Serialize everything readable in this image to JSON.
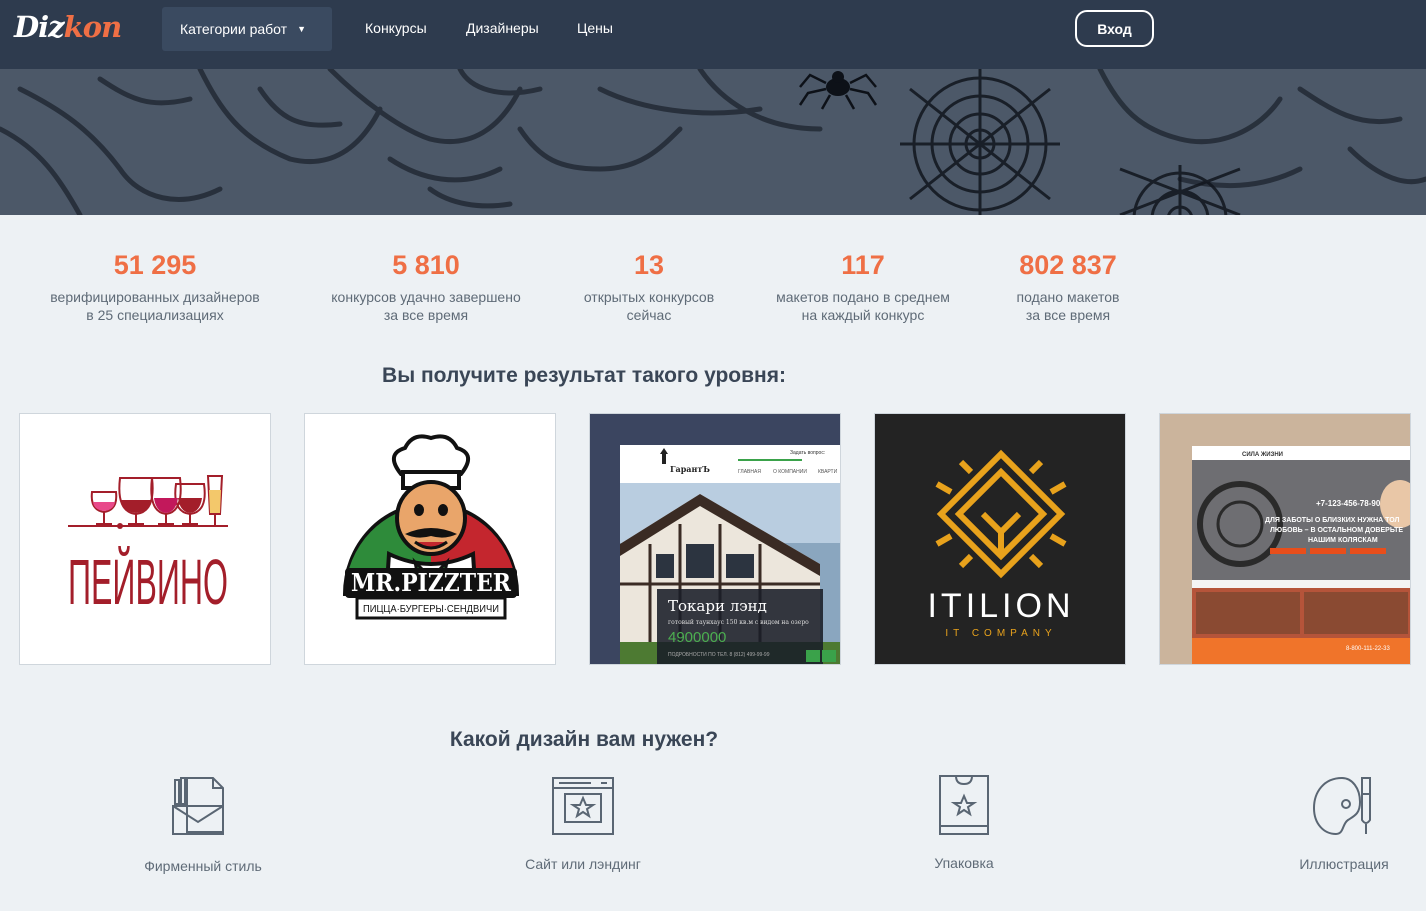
{
  "logo": {
    "part1": "Diz",
    "part2": "kon"
  },
  "nav": {
    "categories_label": "Категории работ",
    "links": [
      "Конкурсы",
      "Дизайнеры",
      "Цены"
    ],
    "login_label": "Вход"
  },
  "stats": [
    {
      "value": "51 295",
      "line1": "верифицированных дизайнеров",
      "line2": "в 25 специализациях"
    },
    {
      "value": "5 810",
      "line1": "конкурсов удачно завершено",
      "line2": "за все время"
    },
    {
      "value": "13",
      "line1": "открытых конкурсов",
      "line2": "сейчас"
    },
    {
      "value": "117",
      "line1": "макетов подано в среднем",
      "line2": "на каждый конкурс"
    },
    {
      "value": "802 837",
      "line1": "подано макетов",
      "line2": "за все время"
    }
  ],
  "results_heading": "Вы получите результат такого уровня:",
  "portfolio": {
    "peivino": {
      "text": "ПЕЙВИНО"
    },
    "pizzter": {
      "title": "MR.PIZZTER",
      "subtitle": "ПИЦЦА·БУРГЕРЫ·СЕНДВИЧИ"
    },
    "garant": {
      "brand": "ГарантЪ",
      "top_note": "Задать вопрос:",
      "menu": [
        "ГЛАВНАЯ",
        "О КОМПАНИИ",
        "КВАРТИ"
      ],
      "title": "Токари лэнд",
      "desc": "готовый таунхаус 150 кв.м с видом на озеро",
      "price": "4900000",
      "phone": "ПОДРОБНОСТИ ПО ТЕЛ. 8 (812) 499-99-99"
    },
    "itilion": {
      "name": "ITILION",
      "sub": "IT COMPANY"
    },
    "sila": {
      "brand": "СИЛА ЖИЗНИ",
      "phone": "+7-123-456-78-90",
      "headline1": "ДЛЯ ЗАБОТЫ О БЛИЗКИХ НУЖНА ТОЛ",
      "headline2": "ЛЮБОВЬ – В ОСТАЛЬНОМ ДОВЕРЬТЕ",
      "headline3": "НАШИМ КОЛЯСКАМ",
      "phone2": "8-800-111-22-33"
    }
  },
  "design_heading": "Какой дизайн вам нужен?",
  "categories": [
    {
      "label": "Фирменный стиль",
      "icon": "brand-identity-icon"
    },
    {
      "label": "Сайт или лэндинг",
      "icon": "website-icon"
    },
    {
      "label": "Упаковка",
      "icon": "packaging-icon"
    },
    {
      "label": "Иллюстрация",
      "icon": "illustration-icon"
    }
  ],
  "colors": {
    "accent": "#ef6f45",
    "nav_bg": "#2e3b4e",
    "page_bg": "#edf1f4"
  }
}
